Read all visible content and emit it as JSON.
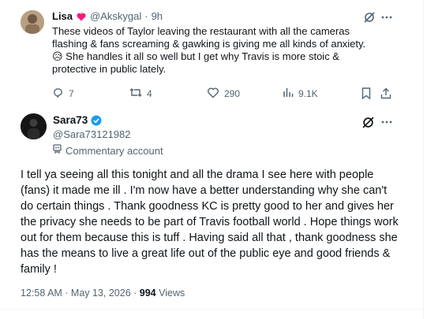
{
  "reply": {
    "name": "Lisa",
    "handle": "@Akskygal",
    "time": "9h",
    "text": "These videos of Taylor leaving the restaurant with all the cameras flashing & fans screaming & gawking is giving me all kinds of anxiety. 😥 She handles it all so well but I get why Travis is more stoic & protective in public lately.",
    "actions": {
      "replies": "7",
      "reposts": "4",
      "likes": "290",
      "views": "9.1K"
    }
  },
  "main": {
    "name": "Sara73",
    "handle": "@Sara73121982",
    "label": "Commentary account",
    "text": "I tell ya seeing all this tonight and all the drama I see here with people (fans) it made me ill . I'm now have a better understanding why she can't do certain things . Thank goodness KC is pretty good to her and gives her the privacy she needs to be part of Travis football world . Hope things work out for them because this is tuff . Having said all that , thank goodness she has the means to live a great life out of the public eye and good friends & family !",
    "timestamp": "12:58 AM · May 13, 2026 · ",
    "views_count": "994",
    "views_label": " Views"
  },
  "colors": {
    "text": "#0f1419",
    "muted": "#536471",
    "border": "#eff3f4",
    "verified": "#1d9bf0",
    "heart": "#f91880"
  },
  "icons": [
    "heart-fire-emoji",
    "grok-icon",
    "more-icon",
    "reply-icon",
    "repost-icon",
    "like-icon",
    "views-icon",
    "bookmark-icon",
    "share-icon",
    "verified-badge-icon",
    "commentary-label-icon"
  ]
}
